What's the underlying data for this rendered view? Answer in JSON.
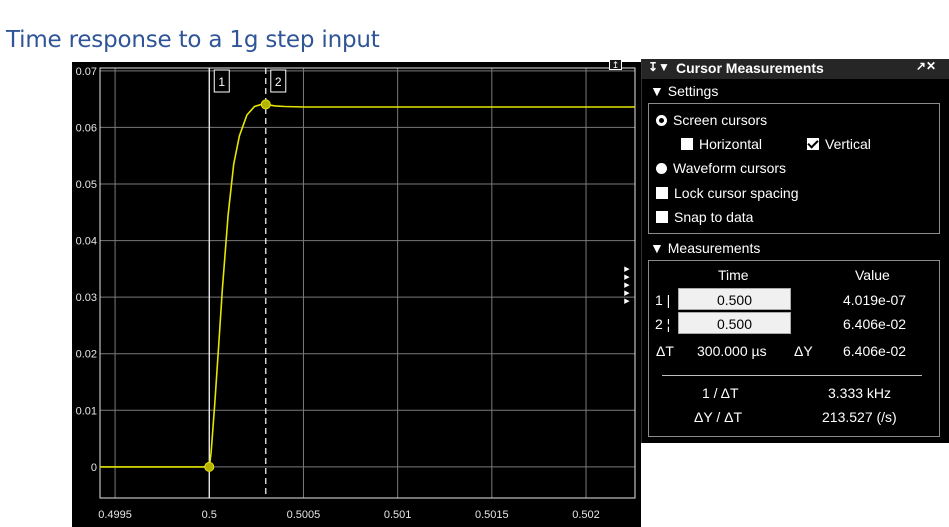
{
  "slide": {
    "title": "Time response to a 1g step input"
  },
  "chart_data": {
    "type": "line",
    "title": "",
    "xlabel": "",
    "ylabel": "",
    "xlim": [
      0.49942,
      0.50226
    ],
    "ylim": [
      -0.0055,
      0.0705
    ],
    "x_ticks": [
      0.4995,
      0.5,
      0.5005,
      0.501,
      0.5015,
      0.502
    ],
    "x_tick_labels": [
      "0.4995",
      "0.5",
      "0.5005",
      "0.501",
      "0.5015",
      "0.502"
    ],
    "y_ticks": [
      0,
      0.01,
      0.02,
      0.03,
      0.04,
      0.05,
      0.06,
      0.07
    ],
    "y_tick_labels": [
      "0",
      "0.01",
      "0.02",
      "0.03",
      "0.04",
      "0.05",
      "0.06",
      "0.07"
    ],
    "grid": true,
    "background": "#000000",
    "line_color": "#e6e600",
    "series": [
      {
        "x": [
          0.49942,
          0.4999,
          0.5,
          0.50001,
          0.50003,
          0.50005,
          0.50007,
          0.5001,
          0.50013,
          0.50016,
          0.5002,
          0.50024,
          0.50028,
          0.5003,
          0.50035,
          0.5004,
          0.5005,
          0.5007,
          0.5012,
          0.50226
        ],
        "y": [
          0.0,
          0.0,
          0.0,
          0.0025,
          0.0115,
          0.0215,
          0.0315,
          0.0445,
          0.0535,
          0.0585,
          0.0622,
          0.0637,
          0.0641,
          0.06406,
          0.0638,
          0.0637,
          0.0636,
          0.0636,
          0.0636,
          0.0636
        ]
      }
    ],
    "cursors": [
      {
        "label": "1",
        "x": 0.5,
        "y": 4.019e-07,
        "style": "solid"
      },
      {
        "label": "2",
        "x": 0.5003,
        "y": 0.06406,
        "style": "dashed"
      }
    ]
  },
  "panel": {
    "title": "Cursor Measurements",
    "pin_icon": "pin-icon",
    "header_controls": "↗✕",
    "settings": {
      "header": "Settings",
      "screen_cursors": "Screen cursors",
      "horizontal": "Horizontal",
      "vertical": "Vertical",
      "waveform_cursors": "Waveform cursors",
      "lock_spacing": "Lock cursor spacing",
      "snap": "Snap to data"
    },
    "measurements": {
      "header": "Measurements",
      "col_time": "Time",
      "col_value": "Value",
      "row1_label": "1 |",
      "row1_time": "0.500",
      "row1_value": "4.019e-07",
      "row2_label": "2 ¦",
      "row2_time": "0.500",
      "row2_value": "6.406e-02",
      "dt_label": "ΔT",
      "dt_value": "300.000 µs",
      "dy_label": "ΔY",
      "dy_value": "6.406e-02",
      "inv_dt_label": "1 / ΔT",
      "inv_dt_value": "3.333 kHz",
      "slope_label": "ΔY / ΔT",
      "slope_value": "213.527 (/s)"
    }
  }
}
